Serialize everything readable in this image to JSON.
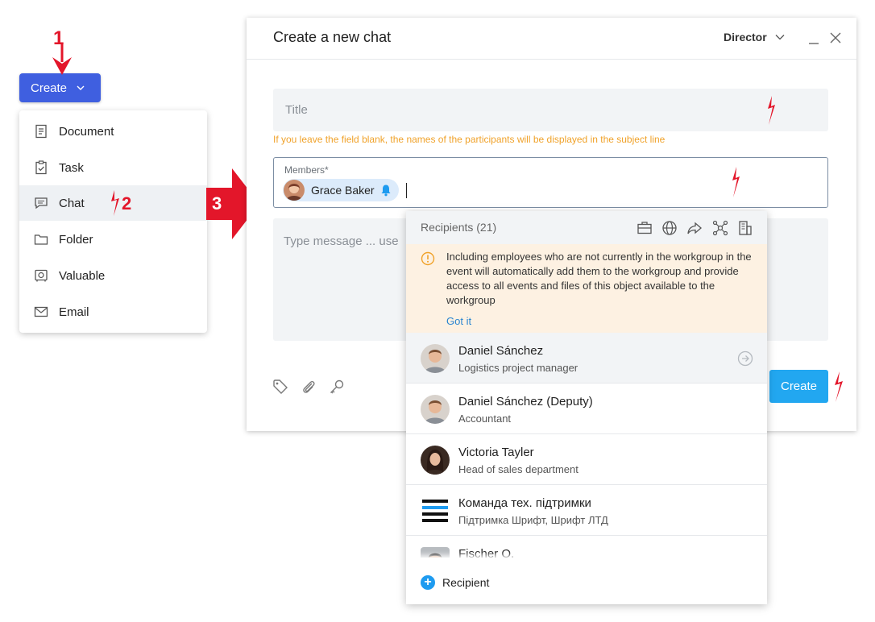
{
  "create_button": {
    "label": "Create"
  },
  "menu": {
    "items": [
      {
        "label": "Document",
        "icon": "document-icon"
      },
      {
        "label": "Task",
        "icon": "task-icon"
      },
      {
        "label": "Chat",
        "icon": "chat-icon"
      },
      {
        "label": "Folder",
        "icon": "folder-icon"
      },
      {
        "label": "Valuable",
        "icon": "safe-icon"
      },
      {
        "label": "Email",
        "icon": "email-icon"
      }
    ],
    "active_index": 2
  },
  "annotations": {
    "step1": "1",
    "step2": "2",
    "step3": "3"
  },
  "dialog": {
    "title": "Create a new chat",
    "role": "Director",
    "title_placeholder": "Title",
    "hint": "If you leave the field blank, the names of the participants will be displayed in the subject line",
    "members_label": "Members*",
    "member_chip": "Grace Baker",
    "message_placeholder": "Type message ... use ",
    "submit_label": "Create"
  },
  "recipients": {
    "title": "Recipients (21)",
    "notice": "Including employees who are not currently in the workgroup in the event will automatically add them to the workgroup and provide access to all events and files of this object available to the workgroup",
    "notice_link": "Got it",
    "list": [
      {
        "name": "Daniel Sánchez",
        "role": "Logistics project manager"
      },
      {
        "name": "Daniel Sánchez (Deputy)",
        "role": "Accountant"
      },
      {
        "name": "Victoria Tayler",
        "role": "Head of sales department"
      },
      {
        "name": "Команда тех. підтримки",
        "role": "Підтримка Шрифт, Шрифт ЛТД"
      },
      {
        "name": "Fischer O.",
        "role": ""
      }
    ],
    "add_label": "Recipient"
  },
  "colors": {
    "primary": "#3f5fe0",
    "accent": "#22a7f0",
    "annotation": "#e3162a",
    "hint": "#f0a22a",
    "notice_bg": "#fdf1e2"
  }
}
